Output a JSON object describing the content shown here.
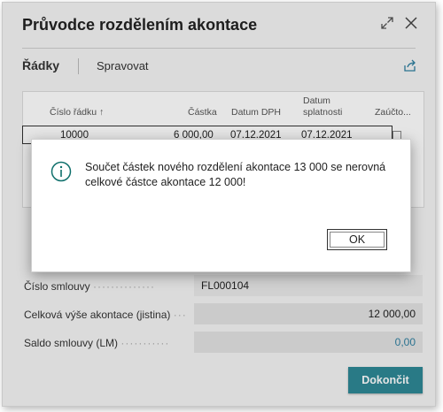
{
  "window": {
    "title": "Průvodce rozdělením akontace",
    "expand_icon": "expand-arrows-icon",
    "close_icon": "close-icon"
  },
  "actions": {
    "lines_label": "Řádky",
    "manage_label": "Spravovat",
    "share_icon": "share-icon"
  },
  "grid": {
    "columns": [
      "Číslo řádku ↑",
      "Částka",
      "Datum DPH",
      "Datum splatnosti",
      "Zaúčto..."
    ],
    "rows": [
      {
        "line_no": "10000",
        "amount": "6 000,00",
        "vat_date": "07.12.2021",
        "due_date": "07.12.2021",
        "posted": false
      }
    ]
  },
  "fields": {
    "contract_label": "Číslo smlouvy",
    "contract_value": "FL000104",
    "total_label": "Celková výše akontace (jistina)",
    "total_value": "12 000,00",
    "balance_label": "Saldo smlouvy (LM)",
    "balance_value": "0,00"
  },
  "finish_label": "Dokončit",
  "dialog": {
    "icon": "info-icon",
    "message": "Součet částek nového rozdělení akontace 13 000 se nerovná celkové částce akontace 12 000!",
    "ok_label": "OK"
  },
  "colors": {
    "accent": "#2e8896",
    "info": "#0e6f6b"
  }
}
